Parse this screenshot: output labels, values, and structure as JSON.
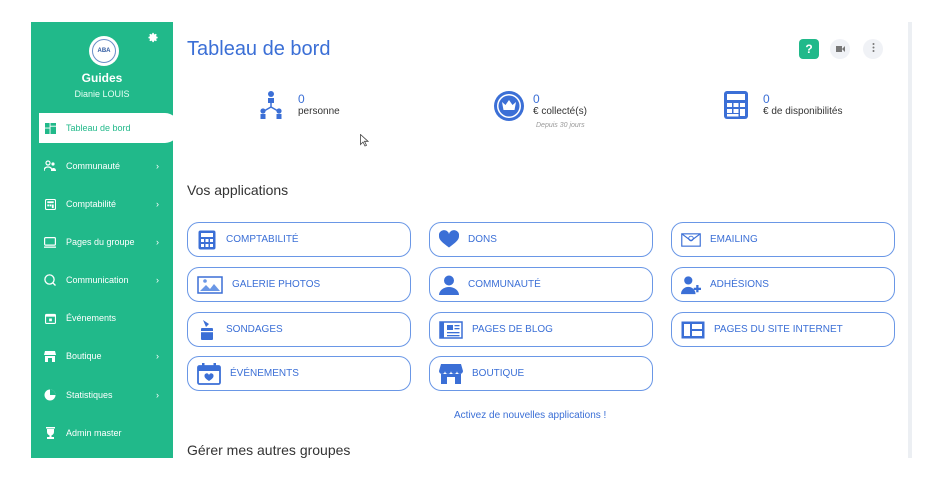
{
  "sidebar": {
    "group_name": "Guides",
    "user_name": "Dianie LOUIS",
    "logo_text": "ABA",
    "items": [
      {
        "label": "Tableau de bord",
        "icon": "dashboard-icon"
      },
      {
        "label": "Communauté",
        "icon": "people-icon"
      },
      {
        "label": "Comptabilité",
        "icon": "calculator-icon"
      },
      {
        "label": "Pages du groupe",
        "icon": "monitor-icon"
      },
      {
        "label": "Communication",
        "icon": "chat-icon"
      },
      {
        "label": "Événements",
        "icon": "calendar-icon"
      },
      {
        "label": "Boutique",
        "icon": "shop-icon"
      },
      {
        "label": "Statistiques",
        "icon": "stats-icon"
      },
      {
        "label": "Admin master",
        "icon": "trophy-icon"
      }
    ]
  },
  "header": {
    "title": "Tableau de bord",
    "help_label": "?",
    "video_icon": "video-icon",
    "more_icon": "more-vertical-icon"
  },
  "stats": [
    {
      "value": "0",
      "label": "personne",
      "sub": "",
      "icon": "people-tree-icon"
    },
    {
      "value": "0",
      "label": "€ collecté(s)",
      "sub": "Depuis 30 jours",
      "icon": "crown-icon"
    },
    {
      "value": "0",
      "label": "€ de disponibilités",
      "sub": "",
      "icon": "calculator-icon"
    }
  ],
  "apps_section": {
    "title": "Vos applications",
    "apps": [
      {
        "label": "COMPTABILITÉ",
        "icon": "calculator-icon"
      },
      {
        "label": "DONS",
        "icon": "heart-icon"
      },
      {
        "label": "EMAILING",
        "icon": "envelope-icon"
      },
      {
        "label": "GALERIE PHOTOS",
        "icon": "image-icon"
      },
      {
        "label": "COMMUNAUTÉ",
        "icon": "user-icon"
      },
      {
        "label": "ADHÉSIONS",
        "icon": "user-plus-icon"
      },
      {
        "label": "SONDAGES",
        "icon": "poll-icon"
      },
      {
        "label": "PAGES DE BLOG",
        "icon": "newspaper-icon"
      },
      {
        "label": "PAGES DU SITE INTERNET",
        "icon": "website-icon"
      },
      {
        "label": "ÉVÉNEMENTS",
        "icon": "calendar-icon"
      },
      {
        "label": "BOUTIQUE",
        "icon": "shop-icon"
      }
    ],
    "activate_link": "Activez de nouvelles applications !"
  },
  "groups_section": {
    "title": "Gérer mes autres groupes"
  },
  "colors": {
    "sidebar": "#21b98a",
    "accent": "#3b6fd6",
    "border": "#6a97e6"
  }
}
